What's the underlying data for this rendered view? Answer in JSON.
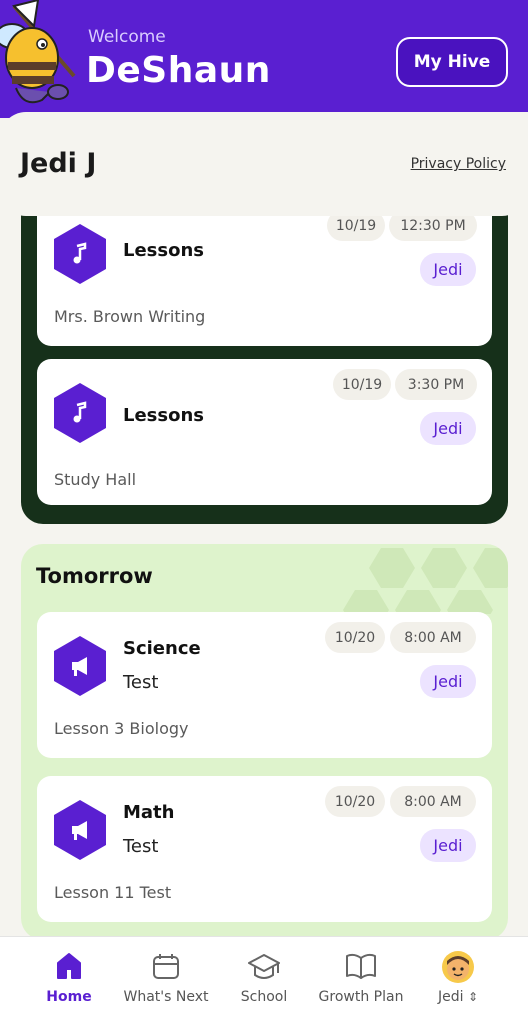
{
  "header": {
    "welcome_label": "Welcome",
    "user_name": "DeShaun",
    "my_hive_label": "My Hive"
  },
  "student_bar": {
    "student_name": "Jedi J",
    "privacy_link": "Privacy Policy"
  },
  "today": {
    "cards": [
      {
        "icon": "music-note-icon",
        "title": "Lessons",
        "subtitle": "",
        "date": "10/19",
        "time": "12:30 PM",
        "tag": "Jedi",
        "description": "Mrs. Brown Writing"
      },
      {
        "icon": "music-note-icon",
        "title": "Lessons",
        "subtitle": "",
        "date": "10/19",
        "time": "3:30 PM",
        "tag": "Jedi",
        "description": "Study Hall"
      }
    ]
  },
  "tomorrow": {
    "title": "Tomorrow",
    "cards": [
      {
        "icon": "megaphone-icon",
        "title": "Science",
        "subtitle": "Test",
        "date": "10/20",
        "time": "8:00 AM",
        "tag": "Jedi",
        "description": "Lesson 3 Biology"
      },
      {
        "icon": "megaphone-icon",
        "title": "Math",
        "subtitle": "Test",
        "date": "10/20",
        "time": "8:00 AM",
        "tag": "Jedi",
        "description": "Lesson 11 Test"
      }
    ]
  },
  "nav": {
    "items": [
      {
        "label": "Home",
        "icon": "home-icon",
        "active": true
      },
      {
        "label": "What's Next",
        "icon": "calendar-icon",
        "active": false
      },
      {
        "label": "School",
        "icon": "graduation-cap-icon",
        "active": false
      },
      {
        "label": "Growth Plan",
        "icon": "open-book-icon",
        "active": false
      },
      {
        "label": "Jedi",
        "icon": "avatar",
        "active": false
      }
    ],
    "switch_glyph": "⇕"
  },
  "colors": {
    "brand_purple": "#5a1fd1",
    "today_panel": "#16301a",
    "tomorrow_panel": "#def3cc",
    "tag_bg": "#ece3ff"
  }
}
